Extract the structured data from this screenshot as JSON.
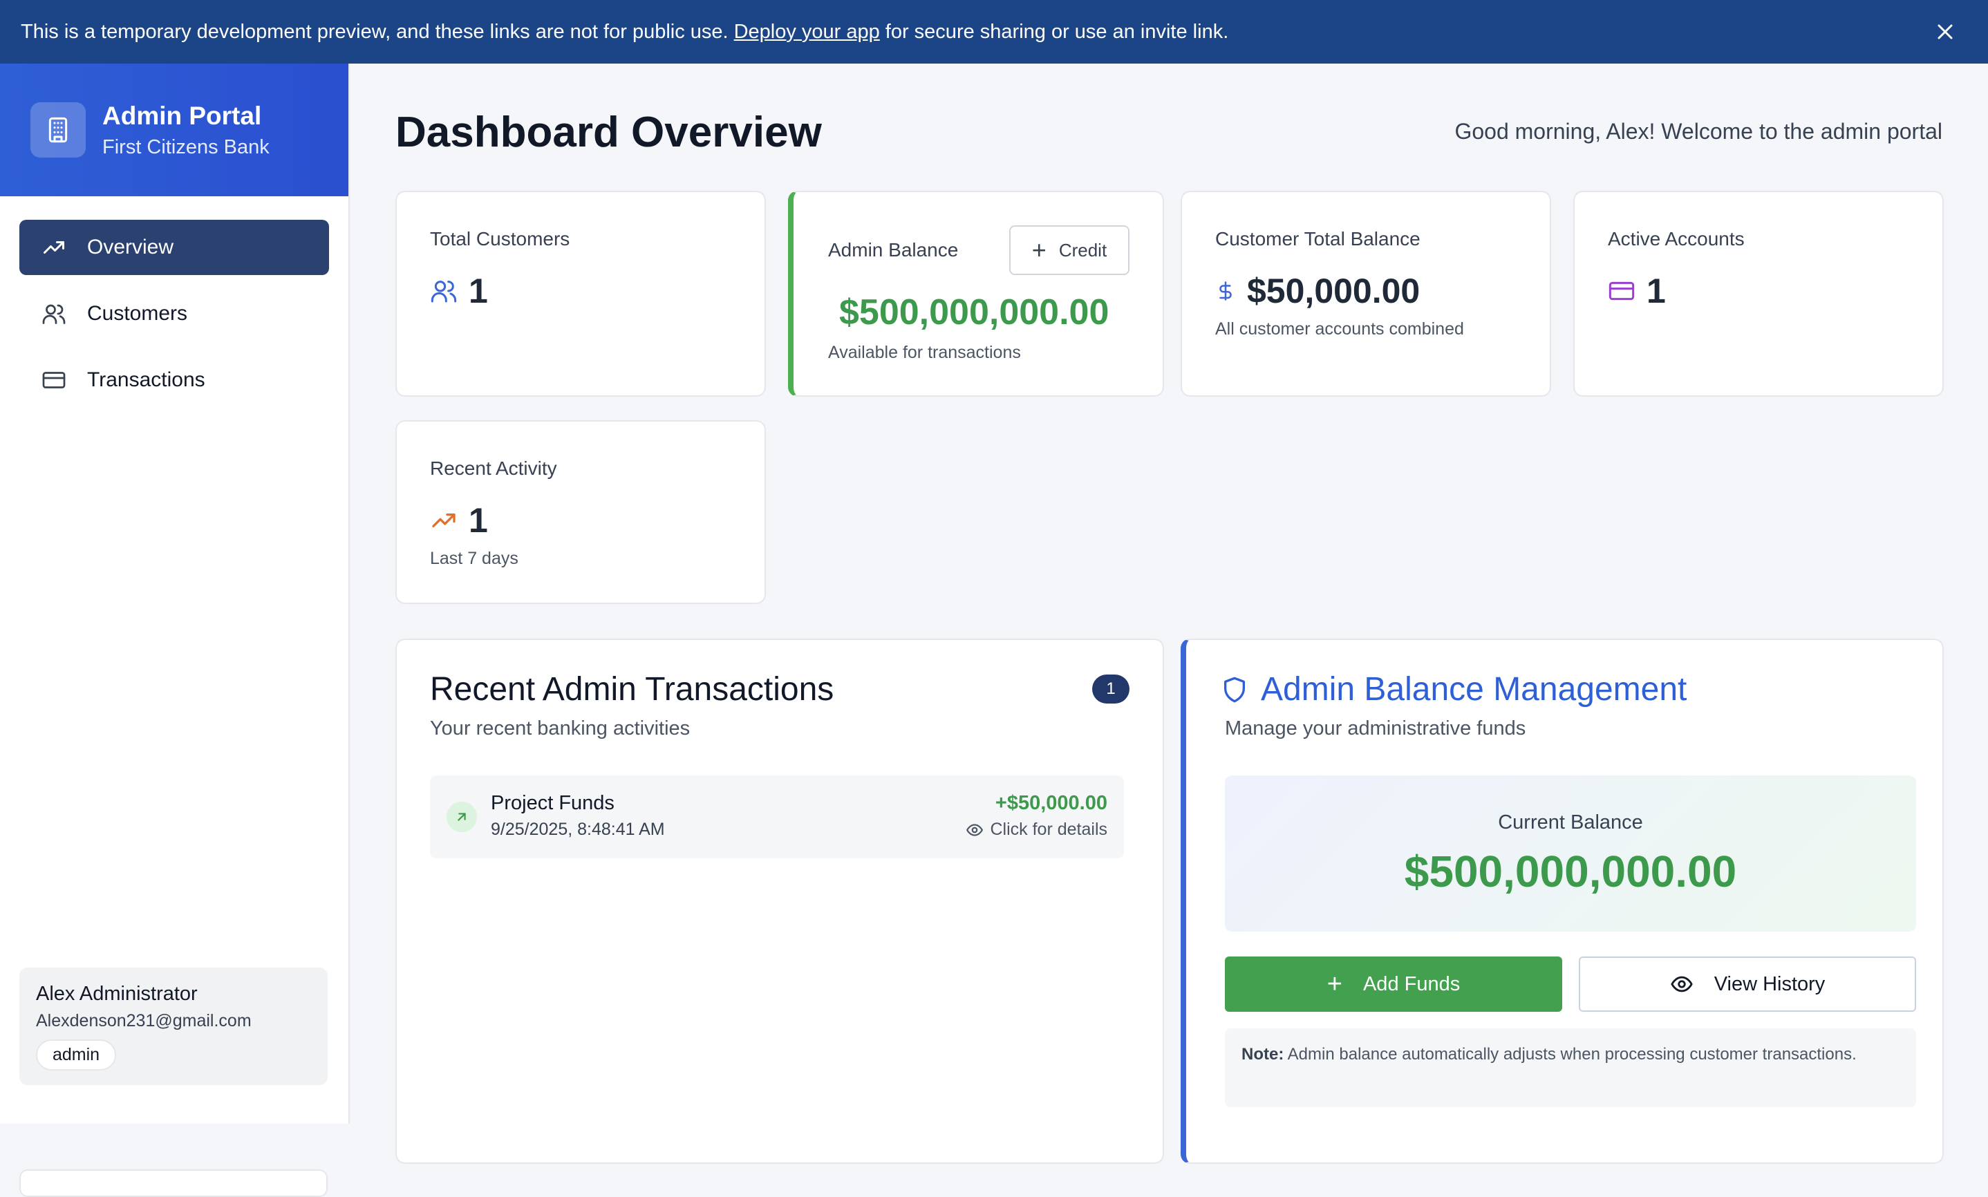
{
  "banner": {
    "text_before": "This is a temporary development preview, and these links are not for public use.",
    "link": "Deploy your app",
    "text_after": "for secure sharing or use an invite link."
  },
  "brand": {
    "title": "Admin Portal",
    "subtitle": "First Citizens Bank"
  },
  "nav": [
    {
      "label": "Overview",
      "icon": "trending-up-icon",
      "active": true
    },
    {
      "label": "Customers",
      "icon": "users-icon",
      "active": false
    },
    {
      "label": "Transactions",
      "icon": "credit-card-icon",
      "active": false
    }
  ],
  "user": {
    "name": "Alex Administrator",
    "email": "Alexdenson231@gmail.com",
    "role": "admin"
  },
  "header": {
    "title": "Dashboard Overview",
    "greeting": "Good morning, Alex! Welcome to the admin portal"
  },
  "stats": {
    "total_customers": {
      "label": "Total Customers",
      "value": "1"
    },
    "admin_balance": {
      "label": "Admin Balance",
      "button": "Credit",
      "value": "$500,000,000.00",
      "sub": "Available for transactions"
    },
    "customer_total": {
      "label": "Customer Total Balance",
      "value": "$50,000.00",
      "sub": "All customer accounts combined"
    },
    "active_accounts": {
      "label": "Active Accounts",
      "value": "1"
    },
    "recent_activity": {
      "label": "Recent Activity",
      "value": "1",
      "sub": "Last 7 days"
    }
  },
  "recent_transactions": {
    "title": "Recent Admin Transactions",
    "subtitle": "Your recent banking activities",
    "count": "1",
    "items": [
      {
        "title": "Project Funds",
        "date": "9/25/2025, 8:48:41 AM",
        "amount": "+$50,000.00",
        "detail": "Click for details"
      }
    ]
  },
  "balance_mgmt": {
    "title": "Admin Balance Management",
    "subtitle": "Manage your administrative funds",
    "current_label": "Current Balance",
    "current_value": "$500,000,000.00",
    "add_funds": "Add Funds",
    "view_history": "View History",
    "note_label": "Note:",
    "note_text": "Admin balance automatically adjusts when processing customer transactions."
  },
  "colors": {
    "banner": "#1c4587",
    "brand": "#2f5fd6",
    "nav_active": "#2b4170",
    "green": "#3d9a4c",
    "blue_accent": "#2f5fd6"
  }
}
